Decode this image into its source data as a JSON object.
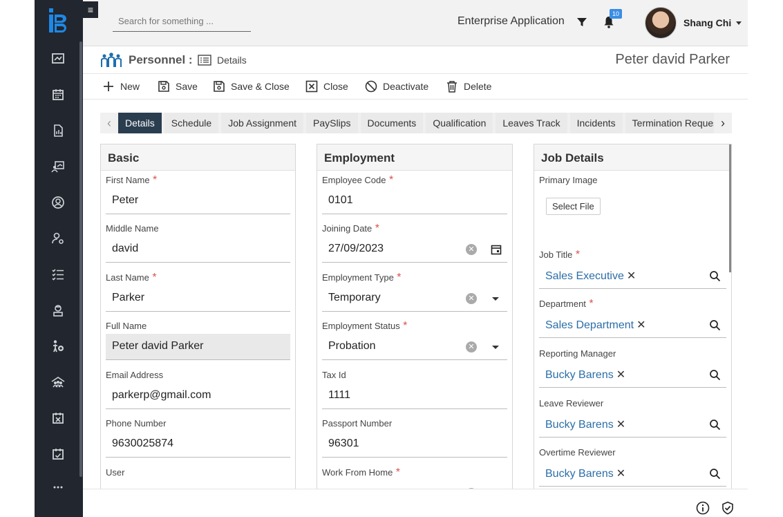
{
  "topbar": {
    "menu_glyph": "≡",
    "search_placeholder": "Search for something ...",
    "app_name": "Enterprise Application",
    "notification_count": "10",
    "user_name": "Shang Chi"
  },
  "title": {
    "module": "Personnel :",
    "view": "Details",
    "record_name": "Peter david Parker"
  },
  "toolbar": {
    "new": "New",
    "save": "Save",
    "save_close": "Save & Close",
    "close": "Close",
    "deactivate": "Deactivate",
    "delete": "Delete"
  },
  "tabs": [
    "Details",
    "Schedule",
    "Job Assignment",
    "PaySlips",
    "Documents",
    "Qualification",
    "Leaves Track",
    "Incidents",
    "Termination Requests"
  ],
  "active_tab": "Details",
  "basic": {
    "title": "Basic",
    "first_name_label": "First Name",
    "first_name": "Peter",
    "middle_name_label": "Middle Name",
    "middle_name": "david",
    "last_name_label": "Last Name",
    "last_name": "Parker",
    "full_name_label": "Full Name",
    "full_name": "Peter david Parker",
    "email_label": "Email Address",
    "email": "parkerp@gmail.com",
    "phone_label": "Phone Number",
    "phone": "9630025874",
    "user_label": "User"
  },
  "employment": {
    "title": "Employment",
    "code_label": "Employee Code",
    "code": "0101",
    "joining_label": "Joining Date",
    "joining": "27/09/2023",
    "type_label": "Employment Type",
    "type": "Temporary",
    "status_label": "Employment Status",
    "status": "Probation",
    "tax_label": "Tax Id",
    "tax": "1111",
    "passport_label": "Passport Number",
    "passport": "96301",
    "wfh_label": "Work From Home"
  },
  "job": {
    "title": "Job Details",
    "image_label": "Primary Image",
    "select_file": "Select File",
    "job_title_label": "Job Title",
    "job_title": "Sales Executive",
    "department_label": "Department",
    "department": "Sales Department",
    "reporting_label": "Reporting Manager",
    "reporting": "Bucky Barens",
    "leave_label": "Leave Reviewer",
    "leave": "Bucky Barens",
    "overtime_label": "Overtime Reviewer",
    "overtime": "Bucky Barens"
  },
  "required_mark": "*",
  "remove_mark": "✕",
  "clear_mark": "✕",
  "colors": {
    "sidebar_bg": "#22262e",
    "active_tab_bg": "#2b3e50",
    "link_value": "#2b6ea8",
    "badge": "#3a8ee6",
    "logo": "#1e88e5"
  }
}
